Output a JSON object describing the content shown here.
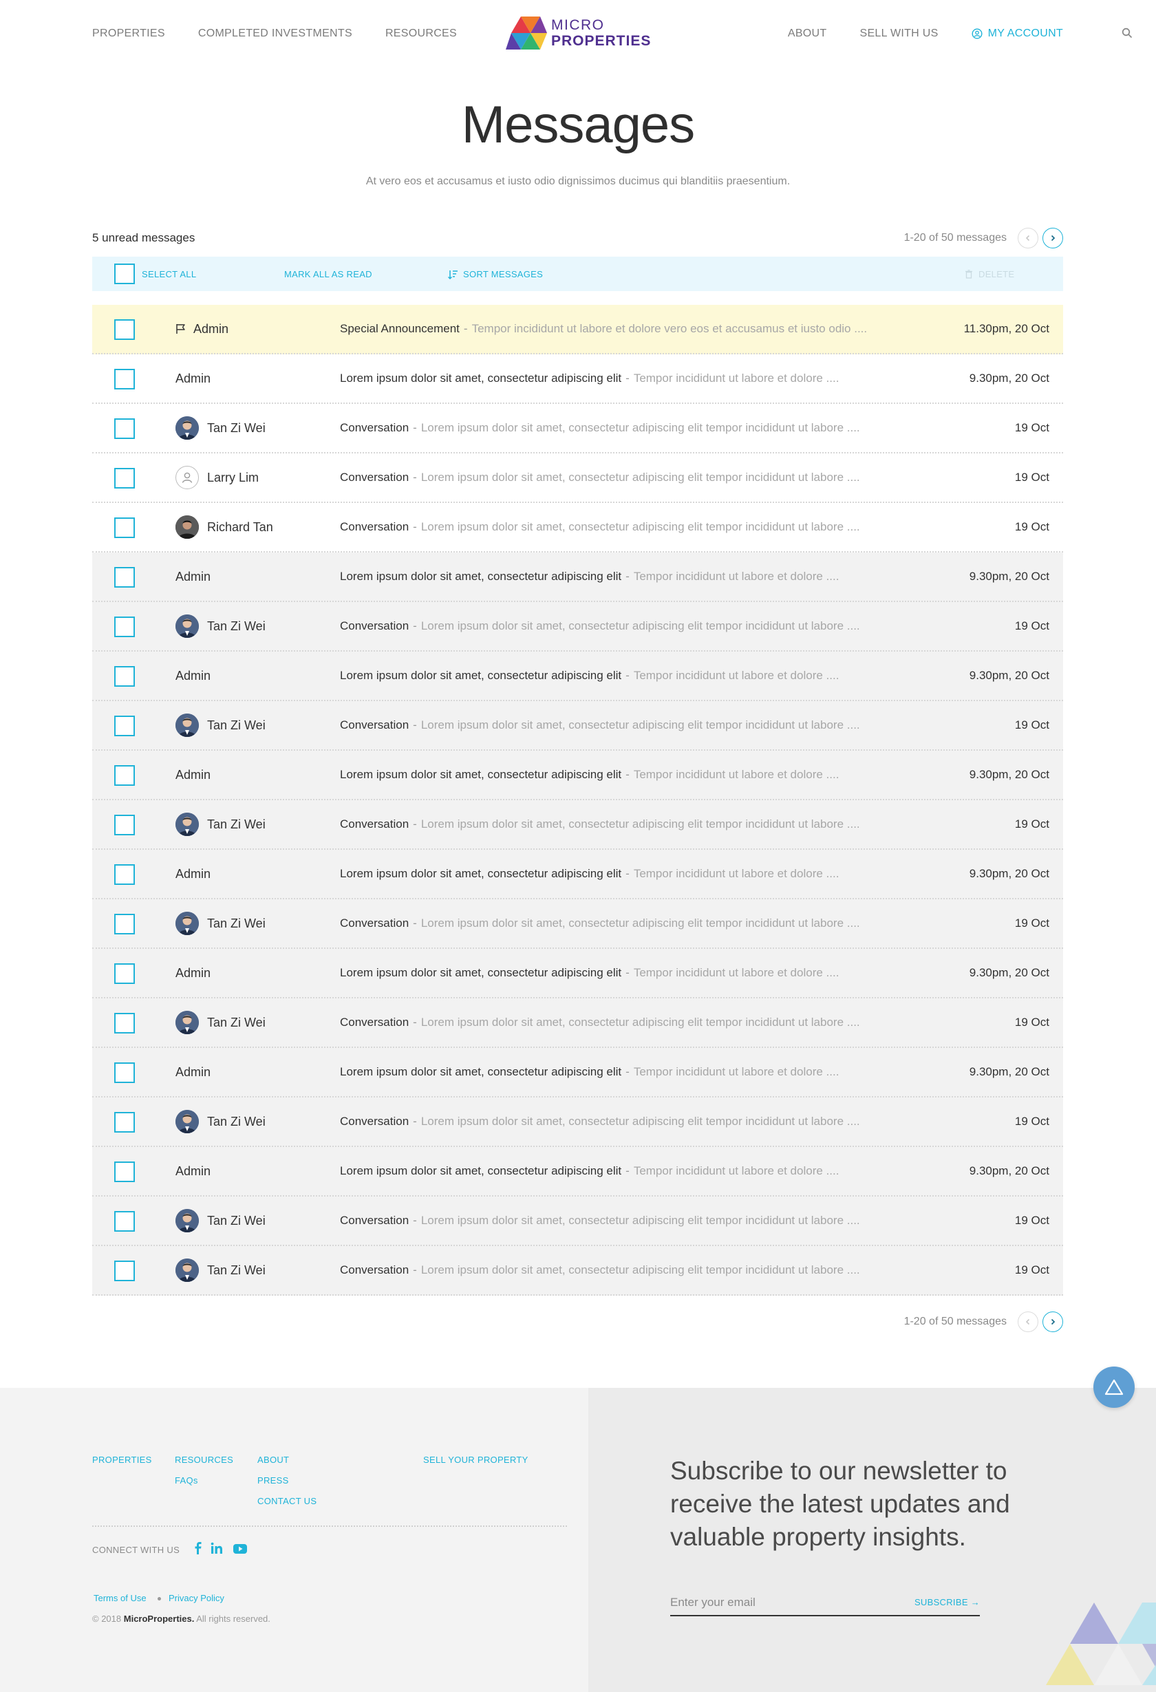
{
  "nav": {
    "left": [
      "PROPERTIES",
      "COMPLETED INVESTMENTS",
      "RESOURCES"
    ],
    "right": [
      "ABOUT",
      "SELL WITH US"
    ],
    "account": "MY ACCOUNT",
    "logo_line1": "MICRO",
    "logo_line2": "PROPERTIES"
  },
  "page": {
    "title": "Messages",
    "subtitle": "At vero eos et accusamus et iusto odio dignissimos ducimus qui blanditiis praesentium."
  },
  "inbox": {
    "unread_count": "5 unread messages",
    "pagination": "1-20 of 50 messages"
  },
  "toolbar": {
    "select_all": "SELECT ALL",
    "mark_all_read": "MARK ALL AS READ",
    "sort": "SORT MESSAGES",
    "delete": "DELETE"
  },
  "messages": [
    {
      "type": "highlight",
      "icon": "flag-icon",
      "sender": "Admin",
      "subject": "Special Announcement",
      "preview": "Tempor incididunt ut labore et dolore vero eos et accusamus et iusto odio ....",
      "date": "11.30pm, 20 Oct"
    },
    {
      "type": "unread",
      "icon": "",
      "sender": "Admin",
      "subject": "Lorem ipsum dolor sit amet, consectetur adipiscing elit",
      "preview": "Tempor incididunt ut labore et dolore ....",
      "date": "9.30pm, 20 Oct"
    },
    {
      "type": "unread",
      "icon": "avatar-photo",
      "sender": "Tan Zi Wei",
      "subject": "Conversation",
      "preview": "Lorem ipsum dolor sit amet, consectetur adipiscing elit tempor incididunt ut labore ....",
      "date": "19 Oct"
    },
    {
      "type": "unread",
      "icon": "avatar-placeholder",
      "sender": "Larry Lim",
      "subject": "Conversation",
      "preview": "Lorem ipsum dolor sit amet, consectetur adipiscing elit tempor incididunt ut labore ....",
      "date": "19 Oct"
    },
    {
      "type": "unread",
      "icon": "avatar-photo-dark",
      "sender": "Richard Tan",
      "subject": "Conversation",
      "preview": "Lorem ipsum dolor sit amet, consectetur adipiscing elit tempor incididunt ut labore ....",
      "date": "19 Oct"
    },
    {
      "type": "read",
      "icon": "",
      "sender": "Admin",
      "subject": "Lorem ipsum dolor sit amet, consectetur adipiscing elit",
      "preview": "Tempor incididunt ut labore et dolore ....",
      "date": "9.30pm, 20 Oct"
    },
    {
      "type": "read",
      "icon": "avatar-photo",
      "sender": "Tan Zi Wei",
      "subject": "Conversation",
      "preview": "Lorem ipsum dolor sit amet, consectetur adipiscing elit tempor incididunt ut labore ....",
      "date": "19 Oct"
    },
    {
      "type": "read",
      "icon": "",
      "sender": "Admin",
      "subject": "Lorem ipsum dolor sit amet, consectetur adipiscing elit",
      "preview": "Tempor incididunt ut labore et dolore ....",
      "date": "9.30pm, 20 Oct"
    },
    {
      "type": "read",
      "icon": "avatar-photo",
      "sender": "Tan Zi Wei",
      "subject": "Conversation",
      "preview": "Lorem ipsum dolor sit amet, consectetur adipiscing elit tempor incididunt ut labore ....",
      "date": "19 Oct"
    },
    {
      "type": "read",
      "icon": "",
      "sender": "Admin",
      "subject": "Lorem ipsum dolor sit amet, consectetur adipiscing elit",
      "preview": "Tempor incididunt ut labore et dolore ....",
      "date": "9.30pm, 20 Oct"
    },
    {
      "type": "read",
      "icon": "avatar-photo",
      "sender": "Tan Zi Wei",
      "subject": "Conversation",
      "preview": "Lorem ipsum dolor sit amet, consectetur adipiscing elit tempor incididunt ut labore ....",
      "date": "19 Oct"
    },
    {
      "type": "read",
      "icon": "",
      "sender": "Admin",
      "subject": "Lorem ipsum dolor sit amet, consectetur adipiscing elit",
      "preview": "Tempor incididunt ut labore et dolore ....",
      "date": "9.30pm, 20 Oct"
    },
    {
      "type": "read",
      "icon": "avatar-photo",
      "sender": "Tan Zi Wei",
      "subject": "Conversation",
      "preview": "Lorem ipsum dolor sit amet, consectetur adipiscing elit tempor incididunt ut labore ....",
      "date": "19 Oct"
    },
    {
      "type": "read",
      "icon": "",
      "sender": "Admin",
      "subject": "Lorem ipsum dolor sit amet, consectetur adipiscing elit",
      "preview": "Tempor incididunt ut labore et dolore ....",
      "date": "9.30pm, 20 Oct"
    },
    {
      "type": "read",
      "icon": "avatar-photo",
      "sender": "Tan Zi Wei",
      "subject": "Conversation",
      "preview": "Lorem ipsum dolor sit amet, consectetur adipiscing elit tempor incididunt ut labore ....",
      "date": "19 Oct"
    },
    {
      "type": "read",
      "icon": "",
      "sender": "Admin",
      "subject": "Lorem ipsum dolor sit amet, consectetur adipiscing elit",
      "preview": "Tempor incididunt ut labore et dolore ....",
      "date": "9.30pm, 20 Oct"
    },
    {
      "type": "read",
      "icon": "avatar-photo",
      "sender": "Tan Zi Wei",
      "subject": "Conversation",
      "preview": "Lorem ipsum dolor sit amet, consectetur adipiscing elit tempor incididunt ut labore ....",
      "date": "19 Oct"
    },
    {
      "type": "read",
      "icon": "",
      "sender": "Admin",
      "subject": "Lorem ipsum dolor sit amet, consectetur adipiscing elit",
      "preview": "Tempor incididunt ut labore et dolore ....",
      "date": "9.30pm, 20 Oct"
    },
    {
      "type": "read",
      "icon": "avatar-photo",
      "sender": "Tan Zi Wei",
      "subject": "Conversation",
      "preview": "Lorem ipsum dolor sit amet, consectetur adipiscing elit tempor incididunt ut labore ....",
      "date": "19 Oct"
    },
    {
      "type": "read",
      "icon": "avatar-photo",
      "sender": "Tan Zi Wei",
      "subject": "Conversation",
      "preview": "Lorem ipsum dolor sit amet, consectetur adipiscing elit tempor incididunt ut labore ....",
      "date": "19 Oct"
    }
  ],
  "footer": {
    "links": {
      "properties": "PROPERTIES",
      "resources": "RESOURCES",
      "faqs": "FAQs",
      "about": "ABOUT",
      "press": "PRESS",
      "contact": "CONTACT US",
      "sell": "SELL YOUR PROPERTY"
    },
    "connect": "CONNECT WITH US",
    "terms": "Terms of Use",
    "privacy": "Privacy Policy",
    "copyright_prefix": "© 2018",
    "copyright_brand": "MicroProperties.",
    "copyright_suffix": "All rights reserved.",
    "newsletter": "Subscribe to our newsletter to receive the latest updates and valuable property insights.",
    "email_placeholder": "Enter your email",
    "subscribe": "SUBSCRIBE →"
  },
  "colors": {
    "accent": "#1fb3d8",
    "highlight_row": "#fdf9d7",
    "read_row": "#f2f2f2",
    "toolbar": "#e8f7fd",
    "brand_purple": "#4f2f8f"
  }
}
